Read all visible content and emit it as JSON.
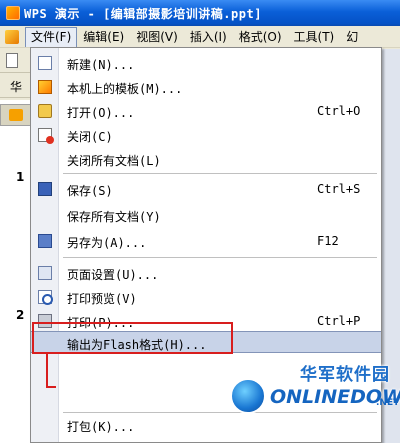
{
  "window": {
    "title": "WPS 演示 - [编辑部摄影培训讲稿.ppt]"
  },
  "menubar": {
    "items": [
      {
        "label": "文件(F)"
      },
      {
        "label": "编辑(E)"
      },
      {
        "label": "视图(V)"
      },
      {
        "label": "插入(I)"
      },
      {
        "label": "格式(O)"
      },
      {
        "label": "工具(T)"
      },
      {
        "label": "幻"
      }
    ]
  },
  "toolbar": {
    "partial_text": "华"
  },
  "slides": {
    "numbers": [
      "1",
      "2"
    ]
  },
  "file_menu": {
    "items": [
      {
        "label": "新建(N)...",
        "shortcut": "",
        "icon": "new-document-icon"
      },
      {
        "label": "本机上的模板(M)...",
        "shortcut": "",
        "icon": "template-icon"
      },
      {
        "label": "打开(O)...",
        "shortcut": "Ctrl+O",
        "icon": "open-folder-icon"
      },
      {
        "label": "关闭(C)",
        "shortcut": "",
        "icon": "close-document-icon"
      },
      {
        "label": "关闭所有文档(L)",
        "shortcut": "",
        "icon": ""
      },
      {
        "label": "保存(S)",
        "shortcut": "Ctrl+S",
        "icon": "save-icon"
      },
      {
        "label": "保存所有文档(Y)",
        "shortcut": "",
        "icon": ""
      },
      {
        "label": "另存为(A)...",
        "shortcut": "F12",
        "icon": "save-as-icon"
      },
      {
        "label": "页面设置(U)...",
        "shortcut": "",
        "icon": "page-setup-icon"
      },
      {
        "label": "打印预览(V)",
        "shortcut": "",
        "icon": "print-preview-icon"
      },
      {
        "label": "打印(P)...",
        "shortcut": "Ctrl+P",
        "icon": "print-icon"
      },
      {
        "label": "输出为Flash格式(H)...",
        "shortcut": "",
        "icon": "",
        "highlighted": true
      },
      {
        "label": "打包(K)...",
        "shortcut": "",
        "icon": ""
      }
    ]
  },
  "watermark": {
    "cn": "华军软件园",
    "en": "ONLINEDOWN",
    "net": ".NET"
  },
  "colors": {
    "highlight": "#c8d3e8",
    "annotation": "#d81e1e",
    "titlebar": "#0a5fd8"
  }
}
